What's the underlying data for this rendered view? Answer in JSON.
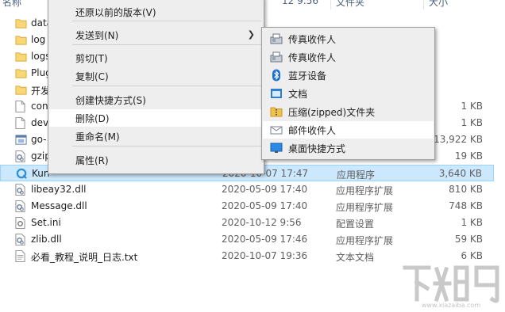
{
  "header": {
    "name": "名称",
    "date_fragment": "12 9:56",
    "type_fragment": "文件夹",
    "size": "大小"
  },
  "files": [
    {
      "name": "data",
      "date": "",
      "type": "",
      "size": "",
      "icon": "folder-icon"
    },
    {
      "name": "log",
      "date": "",
      "type": "",
      "size": "",
      "icon": "folder-icon"
    },
    {
      "name": "logs",
      "date": "",
      "type": "",
      "size": "",
      "icon": "folder-icon"
    },
    {
      "name": "Plug",
      "date": "",
      "type": "",
      "size": "",
      "icon": "folder-icon"
    },
    {
      "name": "开发",
      "date": "",
      "type": "",
      "size": "",
      "icon": "folder-icon"
    },
    {
      "name": "con",
      "date": "",
      "type": "",
      "size": "1 KB",
      "icon": "file-icon"
    },
    {
      "name": "dev",
      "date": "",
      "type": "",
      "size": "1 KB",
      "icon": "file-icon"
    },
    {
      "name": "go-",
      "date": "",
      "type": "",
      "size": "13,922 KB",
      "icon": "exe-icon"
    },
    {
      "name": "gzip",
      "date": "",
      "type": "",
      "size": "19 KB",
      "icon": "dll-icon"
    },
    {
      "name": "Kun",
      "date": "2020-10-07 17:47",
      "type": "应用程序",
      "size": "3,640 KB",
      "icon": "app-q-icon",
      "selected": true
    },
    {
      "name": "libeay32.dll",
      "date": "2020-05-09 17:40",
      "type": "应用程序扩展",
      "size": "810 KB",
      "icon": "dll-icon"
    },
    {
      "name": "Message.dll",
      "date": "2020-05-09 17:40",
      "type": "应用程序扩展",
      "size": "748 KB",
      "icon": "dll-icon"
    },
    {
      "name": "Set.ini",
      "date": "2020-10-12 9:56",
      "type": "配置设置",
      "size": "1 KB",
      "icon": "ini-icon"
    },
    {
      "name": "zlib.dll",
      "date": "2020-05-09 17:46",
      "type": "应用程序扩展",
      "size": "59 KB",
      "icon": "dll-icon"
    },
    {
      "name": "必看_教程_说明_日志.txt",
      "date": "2020-10-07 19:36",
      "type": "文本文档",
      "size": "6 KB",
      "icon": "txt-icon"
    }
  ],
  "context_menu": [
    {
      "label": "还原以前的版本(V)"
    },
    {
      "label": "发送到(N)",
      "submenu": true
    },
    {
      "label": "剪切(T)"
    },
    {
      "label": "复制(C)"
    },
    {
      "label": "创建快捷方式(S)"
    },
    {
      "label": "删除(D)",
      "highlighted": true
    },
    {
      "label": "重命名(M)"
    },
    {
      "label": "属性(R)"
    }
  ],
  "submenu": [
    {
      "label": "传真收件人",
      "icon": "fax-icon"
    },
    {
      "label": "传真收件人",
      "icon": "fax-icon"
    },
    {
      "label": "蓝牙设备",
      "icon": "bluetooth-icon"
    },
    {
      "label": "文档",
      "icon": "document-icon"
    },
    {
      "label": "压缩(zipped)文件夹",
      "icon": "zip-folder-icon"
    },
    {
      "label": "邮件收件人",
      "icon": "mail-icon",
      "highlighted": true
    },
    {
      "label": "桌面快捷方式",
      "icon": "desktop-icon"
    }
  ],
  "watermark": "下载吧",
  "watermark_url": "www.xiazaiba.com"
}
